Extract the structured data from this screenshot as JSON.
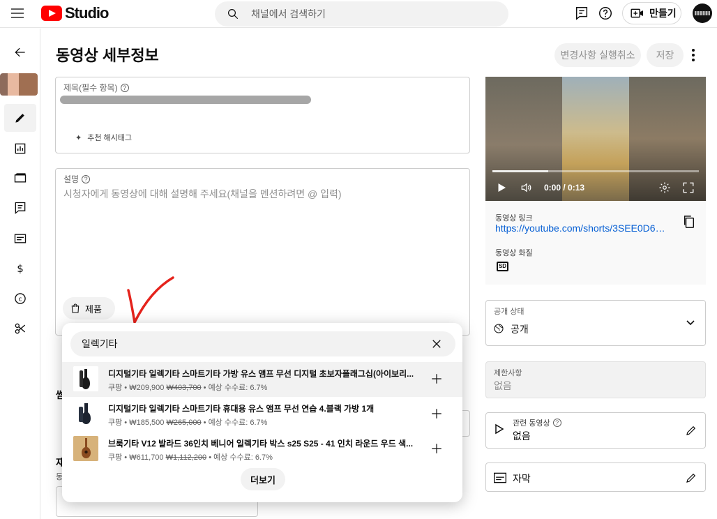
{
  "app": {
    "logo_text": "Studio",
    "brand_color": "#ff0000"
  },
  "search": {
    "placeholder": "채널에서 검색하기"
  },
  "header": {
    "create_label": "만들기"
  },
  "page": {
    "title": "동영상 세부정보",
    "undo_label": "변경사항 실행취소",
    "save_label": "저장"
  },
  "form": {
    "title_label": "제목(필수 항목)",
    "hashtag_label": "추천 해시태그",
    "description_label": "설명",
    "description_placeholder": "시청자에게 동영상에 대해 설명해 주세요(채널을 멘션하려면 @ 입력)",
    "product_chip_label": "제품",
    "thumbnail_label_partial": "썸",
    "playlist_label_partial": "재",
    "playlist_sub_partial": "동"
  },
  "product_popup": {
    "search_value": "일렉기타",
    "more_label": "더보기",
    "items": [
      {
        "title": "디지털기타 일렉기타 스마트기타 가방 유스 앰프 무선 디지털 초보자플래그십(아이보리...",
        "store": "쿠팡",
        "price": "₩209,900",
        "original_price": "₩403,700",
        "commission": "• 예상 수수료: 6.7%",
        "highlighted": true
      },
      {
        "title": "디지털기타 일렉기타 스마트기타 휴대용 유스 앰프 무선 연습 4.블랙 가방 1개",
        "store": "쿠팡",
        "price": "₩185,500",
        "original_price": "₩265,000",
        "commission": "• 예상 수수료: 6.7%",
        "highlighted": false
      },
      {
        "title": "브룩기타 V12 발라드 36인치 베니어 일렉기타 박스 s25 S25 - 41 인치 라운드 우드 색...",
        "store": "쿠팡",
        "price": "₩611,700",
        "original_price": "₩1,112,200",
        "commission": "• 예상 수수료: 6.7%",
        "highlighted": false
      }
    ]
  },
  "video": {
    "time": "0:00 / 0:13",
    "progress_fraction": 0.27,
    "link_label": "동영상 링크",
    "link": "https://youtube.com/shorts/3SEE0D6F...",
    "quality_label": "동영상 화질",
    "quality_badge": "SD"
  },
  "visibility": {
    "label": "공개 상태",
    "value": "공개"
  },
  "restrictions": {
    "label": "제한사항",
    "value": "없음"
  },
  "related": {
    "label": "관련 동영상",
    "value": "없음"
  },
  "subtitles": {
    "label": "자막"
  },
  "icons": {
    "menu": "hamburger-icon",
    "search": "search-icon",
    "feedback": "feedback-icon",
    "help": "help-icon",
    "create": "video-camera-plus-icon",
    "annotation": "red-checkmark"
  },
  "colors": {
    "link": "#065fd4",
    "annotation": "#e5231c"
  }
}
